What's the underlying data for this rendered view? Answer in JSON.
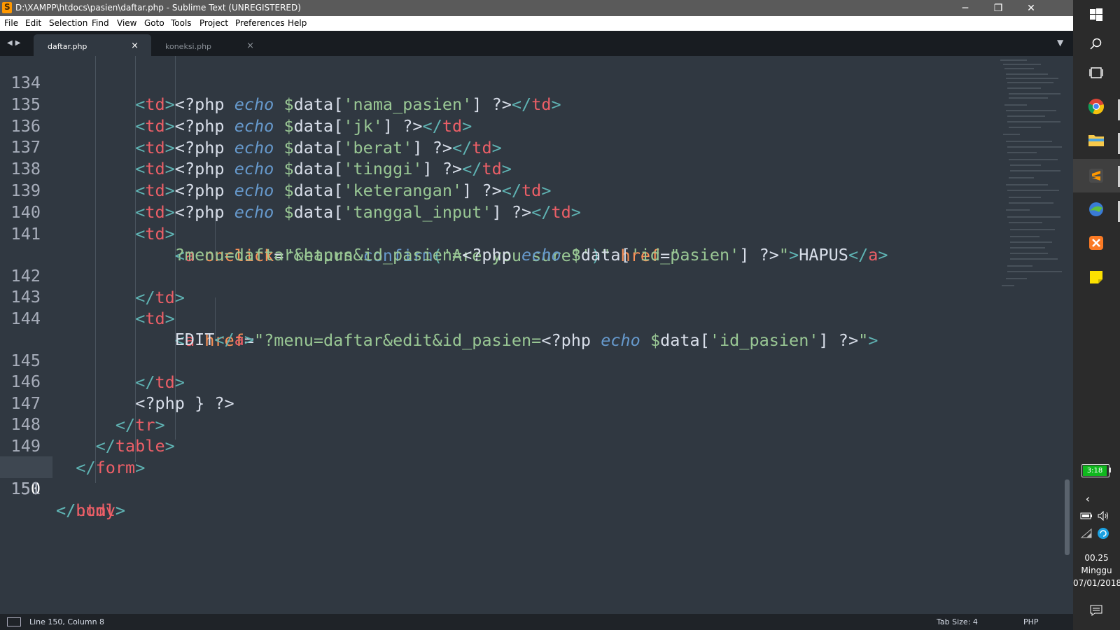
{
  "window": {
    "title": "D:\\XAMPP\\htdocs\\pasien\\daftar.php - Sublime Text (UNREGISTERED)",
    "minimize": "─",
    "maximize": "❐",
    "close": "✕"
  },
  "menu": [
    "File",
    "Edit",
    "Selection",
    "Find",
    "View",
    "Goto",
    "Tools",
    "Project",
    "Preferences",
    "Help"
  ],
  "tabs": [
    {
      "label": "daftar.php",
      "close": "×",
      "active": true
    },
    {
      "label": "koneksi.php",
      "close": "×",
      "active": false
    }
  ],
  "nav_arrows": "◀▶",
  "tab_dropdown": "▼",
  "line_numbers": {
    "l134": "134",
    "l135": "135",
    "l136": "136",
    "l137": "137",
    "l138": "138",
    "l139": "139",
    "l140": "140",
    "l141": "141",
    "l142": "142",
    "l143": "143",
    "l144": "144",
    "l145": "145",
    "l146": "146",
    "l147": "147",
    "l148": "148",
    "l149": "149",
    "l150": "150",
    "l151": "151"
  },
  "code": {
    "lt": "<",
    "gt": ">",
    "lt_slash": "</",
    "php_open": "<?php ",
    "php_close": " ?>",
    "echo": "echo",
    "dollar": "$",
    "var": "data",
    "lb": "[",
    "rb": "]",
    "td": "td",
    "tr": "tr",
    "table": "table",
    "form": "form",
    "body": "body",
    "html": "html",
    "a": "a",
    "k_nama": "'nama_pasien'",
    "k_jk": "'jk'",
    "k_berat": "'berat'",
    "k_tinggi": "'tinggi'",
    "k_ket": "'keterangan'",
    "k_tgl": "'tanggal_input'",
    "k_id": "'id_pasien'",
    "onclick": "onclick",
    "eq": "=",
    "onclick_q1": "\"return ",
    "confirm": "confirm",
    "paren_o": "(",
    "paren_c": ")",
    "confirm_arg": "'Are you sure?'",
    "onclick_q2": "\"",
    "href": "href",
    "href_open": "\"",
    "href_hapus": "?menu=daftar&hapus&id_pasien=",
    "href_edit": "\"?menu=daftar&edit&id_pasien=",
    "quote": "\"",
    "hapus": "HAPUS",
    "edit": "EDIT",
    "php_brace": "<?php } ?>"
  },
  "status": {
    "position": "Line 150, Column 8",
    "tab_size": "Tab Size: 4",
    "syntax": "PHP"
  },
  "taskbar": {
    "battery": "3:18",
    "time": "00.25",
    "day": "Minggu",
    "date": "07/01/2018",
    "icons": [
      "windows-icon",
      "search-icon",
      "task-view-icon",
      "chrome-icon",
      "file-explorer-icon",
      "sublime-icon",
      "idm-icon",
      "xampp-icon",
      "sticky-notes-icon"
    ]
  },
  "colors": {
    "background": "#303841",
    "tag": "#ec5f67",
    "punctuation": "#5fb3b3",
    "attribute": "#f99157",
    "string": "#99c794",
    "keyword": "#6699cc",
    "text": "#d8dee9"
  }
}
